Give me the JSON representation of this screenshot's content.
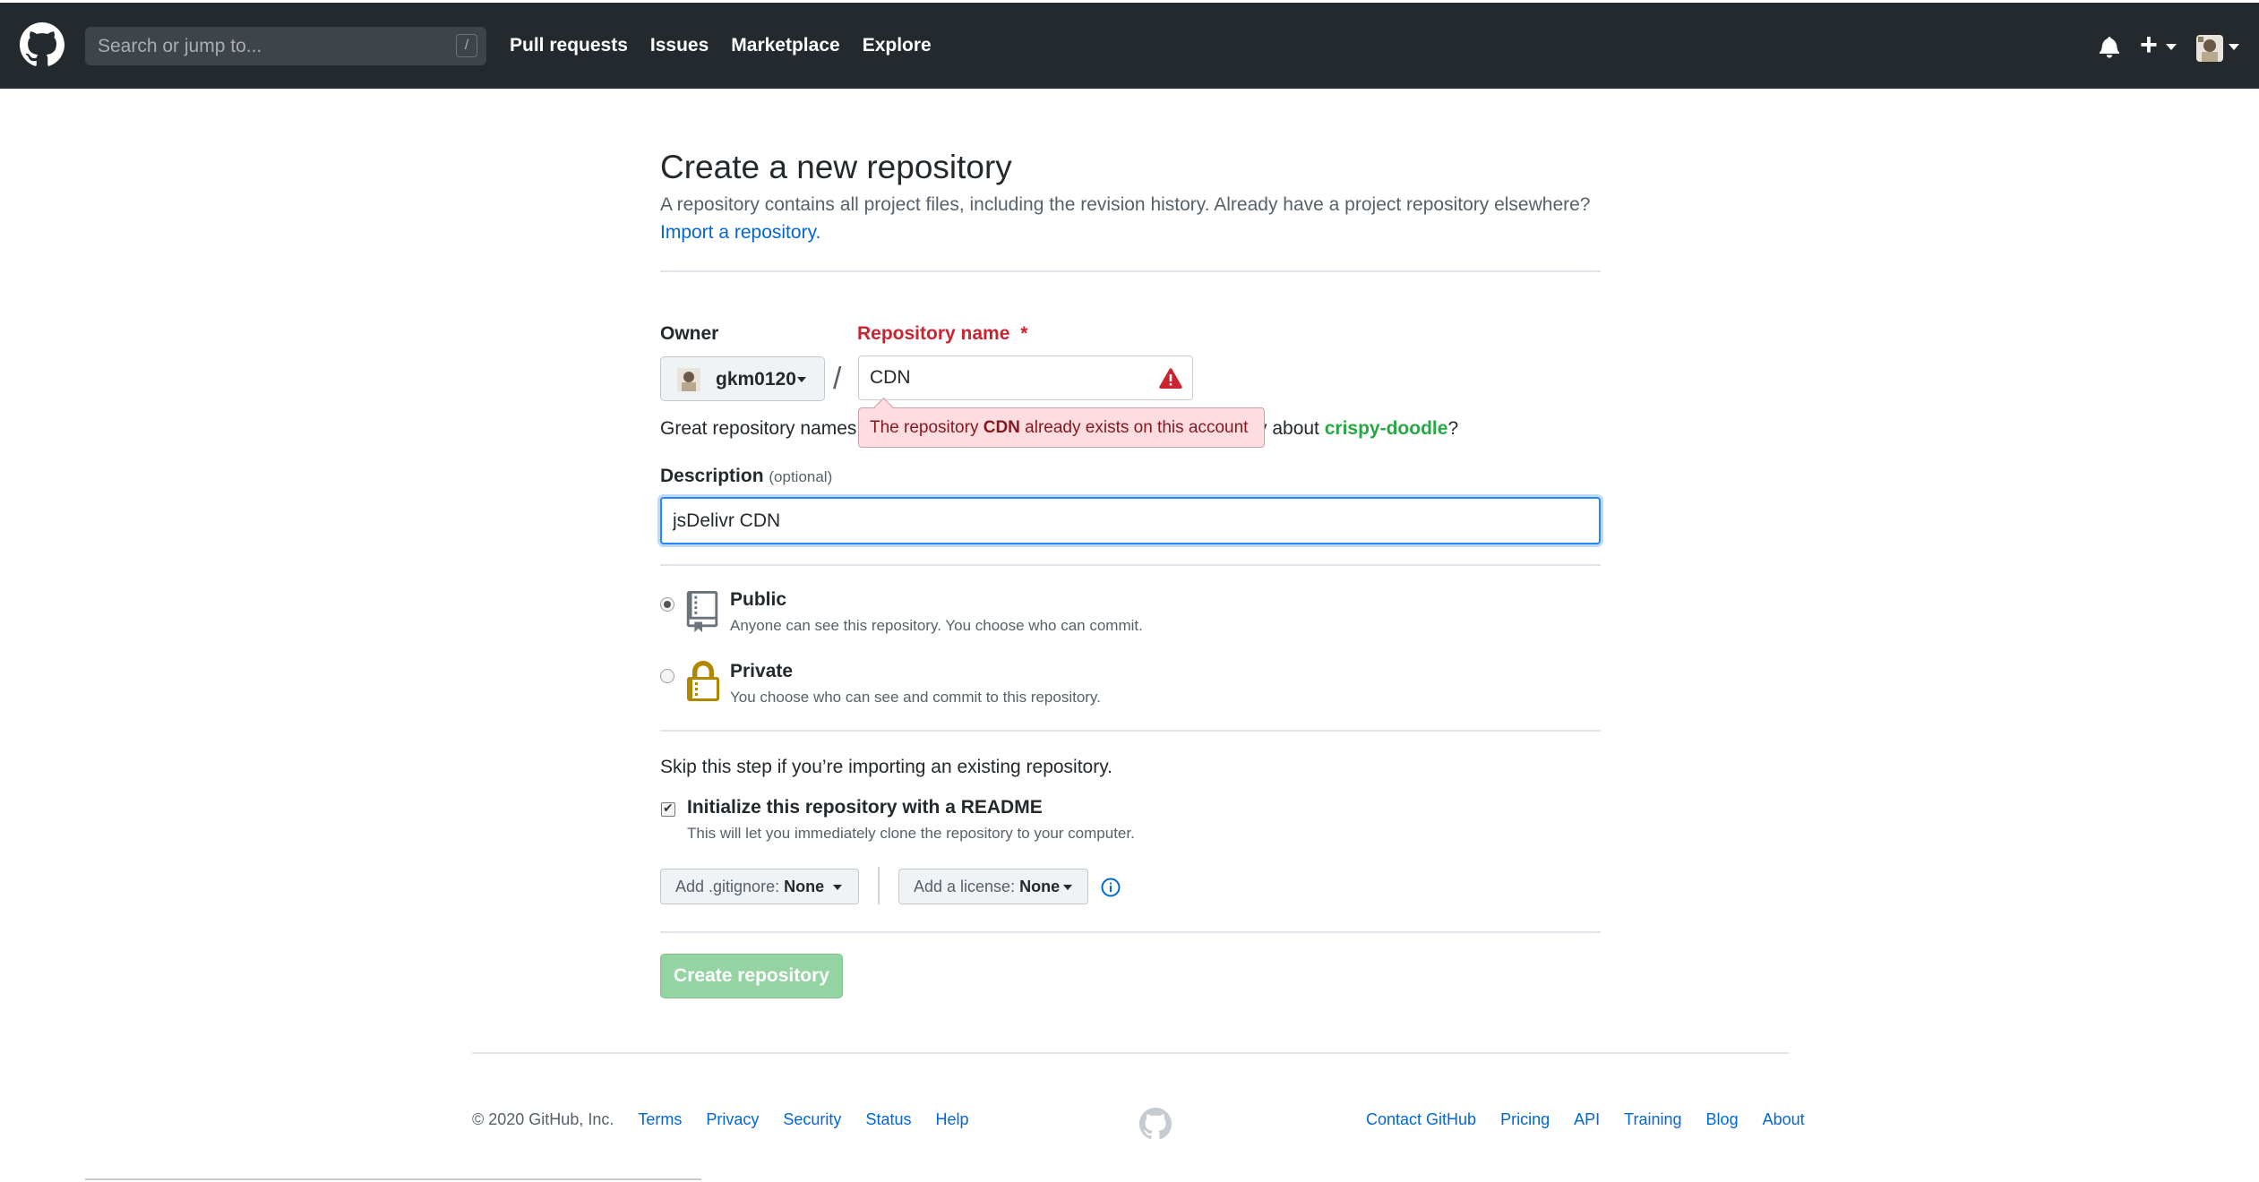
{
  "header": {
    "search_placeholder": "Search or jump to...",
    "search_key": "/",
    "nav": [
      "Pull requests",
      "Issues",
      "Marketplace",
      "Explore"
    ],
    "plus_symbol": "+"
  },
  "page": {
    "title": "Create a new repository",
    "intro": "A repository contains all project files, including the revision history. Already have a project repository elsewhere?",
    "import_link": "Import a repository."
  },
  "form": {
    "owner_label": "Owner",
    "owner_value": "gkm0120",
    "separator": "/",
    "repo_label": "Repository name",
    "required_mark": "*",
    "repo_value": "CDN",
    "error_prefix": "The repository ",
    "error_repo": "CDN",
    "error_suffix": " already exists on this account",
    "hint_left": "Great repository names",
    "hint_right": "y about ",
    "hint_suggestion": "crispy-doodle",
    "hint_end": "?",
    "description_label": "Description",
    "description_optional": "(optional)",
    "description_value": "jsDelivr CDN",
    "visibility": {
      "public_label": "Public",
      "public_desc": "Anyone can see this repository. You choose who can commit.",
      "private_label": "Private",
      "private_desc": "You choose who can see and commit to this repository.",
      "selected": "public"
    },
    "skip_text": "Skip this step if you’re importing an existing repository.",
    "readme_label": "Initialize this repository with a README",
    "readme_desc": "This will let you immediately clone the repository to your computer.",
    "readme_checked": true,
    "gitignore_prefix": "Add .gitignore: ",
    "gitignore_value": "None",
    "license_prefix": "Add a license: ",
    "license_value": "None",
    "create_button": "Create repository"
  },
  "footer": {
    "copyright": "© 2020 GitHub, Inc.",
    "left_links": [
      "Terms",
      "Privacy",
      "Security",
      "Status",
      "Help"
    ],
    "right_links": [
      "Contact GitHub",
      "Pricing",
      "API",
      "Training",
      "Blog",
      "About"
    ]
  },
  "colors": {
    "header_bg": "#24292e",
    "link": "#0366d6",
    "error": "#cb2431",
    "success_disabled": "#94d3a2"
  },
  "icons": [
    "github-logo-icon",
    "bell-icon",
    "plus-icon",
    "warning-icon",
    "repo-book-icon",
    "lock-icon",
    "info-icon"
  ]
}
